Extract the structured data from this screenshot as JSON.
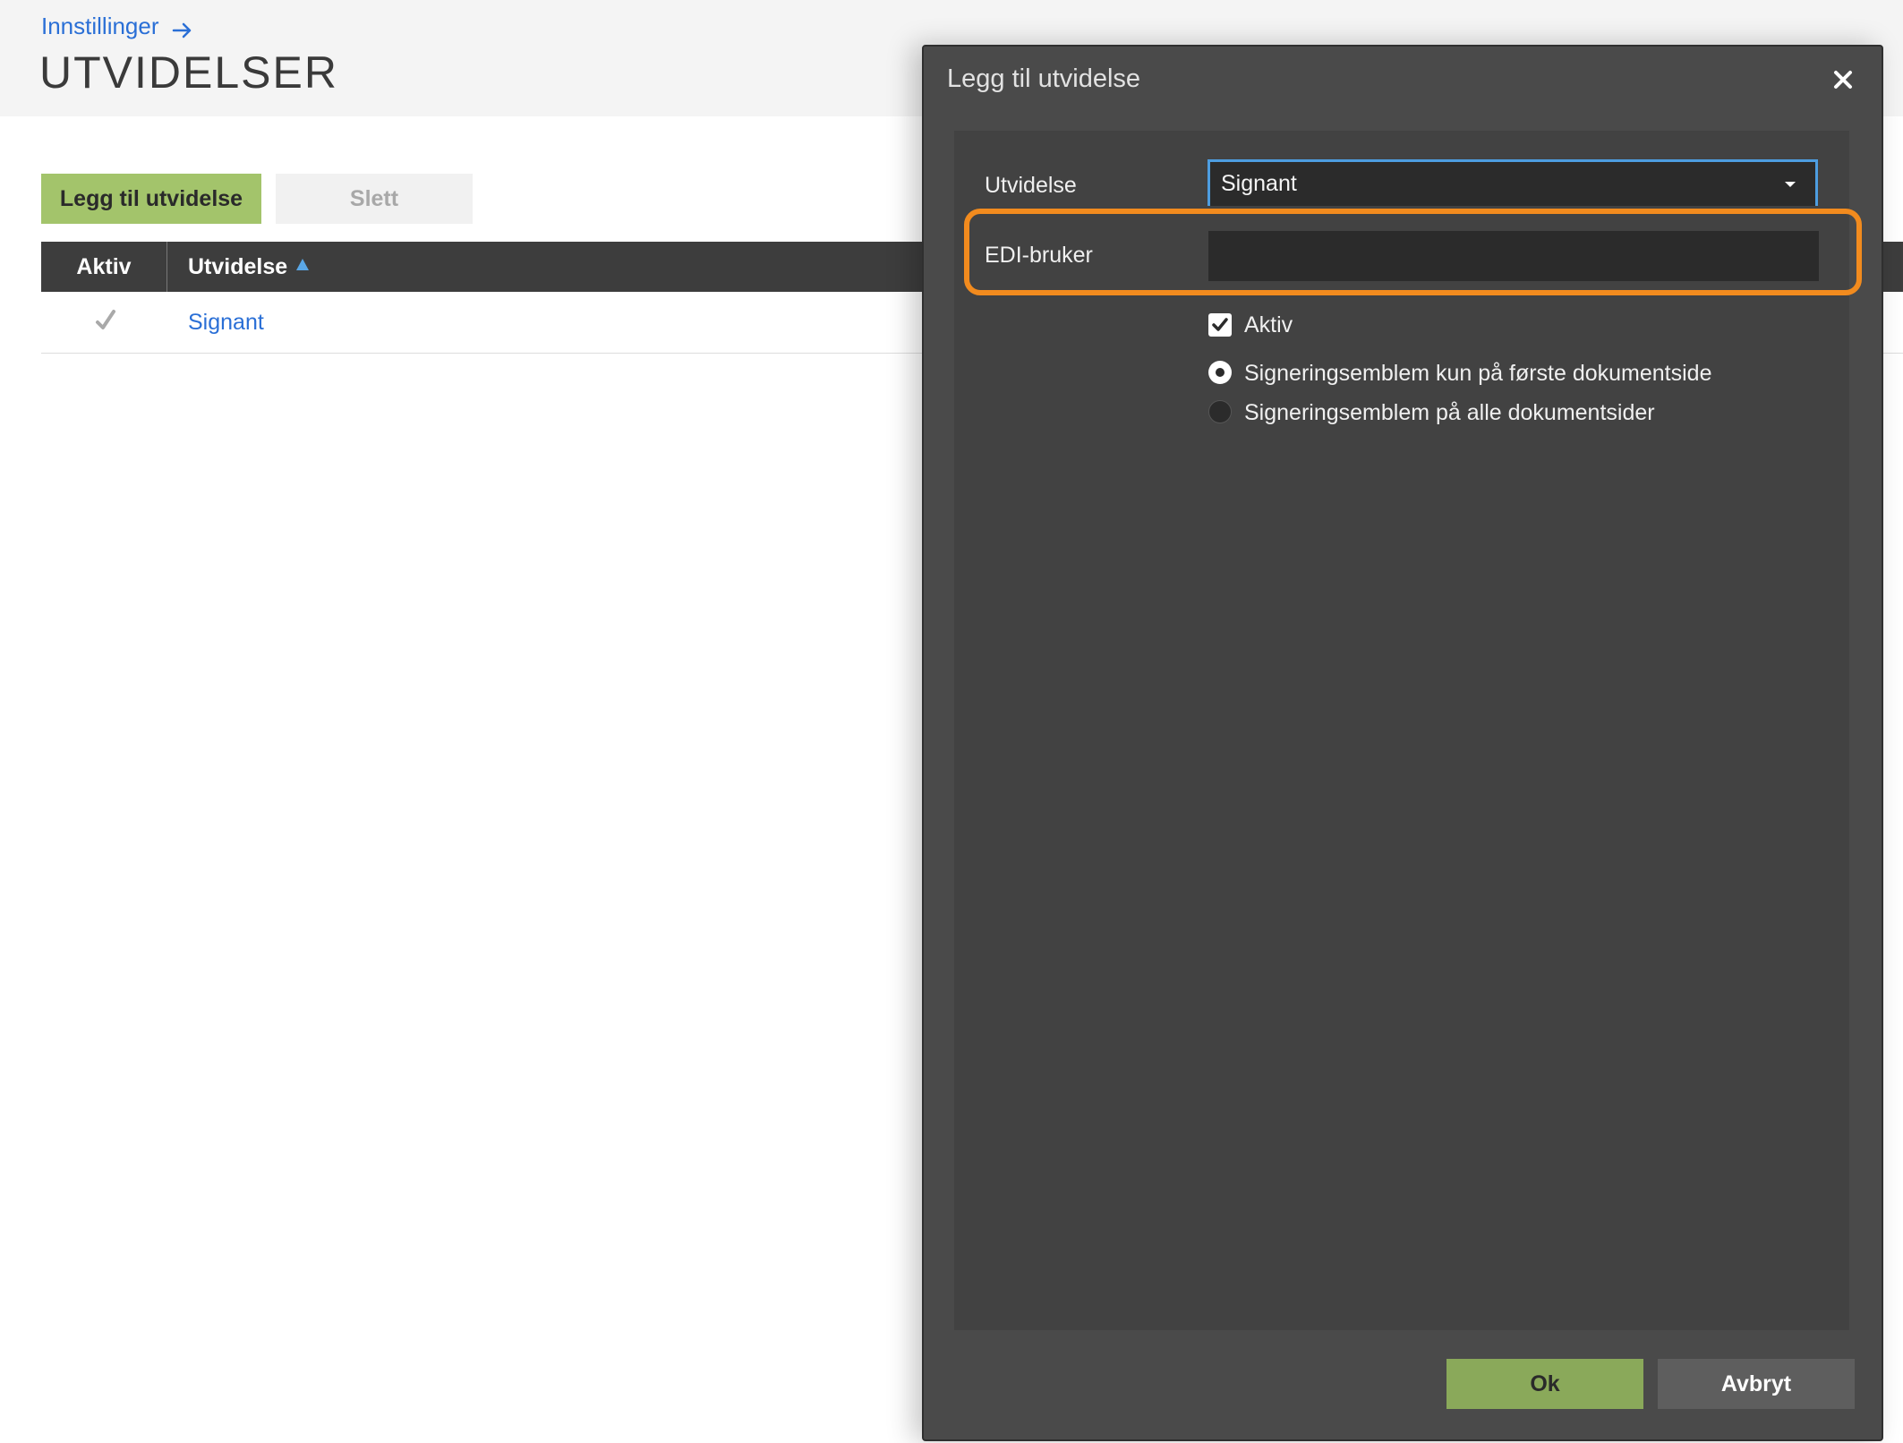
{
  "header": {
    "breadcrumb": "Innstillinger",
    "title": "UTVIDELSER"
  },
  "toolbar": {
    "add_label": "Legg til utvidelse",
    "delete_label": "Slett"
  },
  "table": {
    "columns": [
      "Aktiv",
      "Utvidelse"
    ],
    "rows": [
      {
        "active": true,
        "name": "Signant"
      }
    ]
  },
  "dialog": {
    "title": "Legg til utvidelse",
    "extension_label": "Utvidelse",
    "extension_value": "Signant",
    "edi_label": "EDI-bruker",
    "edi_value": "",
    "active_label": "Aktiv",
    "active_checked": true,
    "radio_options": [
      {
        "label": "Signeringsemblem kun på første dokumentside",
        "selected": true
      },
      {
        "label": "Signeringsemblem på alle dokumentsider",
        "selected": false
      }
    ],
    "ok_label": "Ok",
    "cancel_label": "Avbryt"
  },
  "colors": {
    "link": "#2a6fd6",
    "primary_button": "#a3c46b",
    "dialog_background": "#4a4a4a",
    "highlight": "#f28b1e",
    "focus_border": "#4d9de0"
  }
}
